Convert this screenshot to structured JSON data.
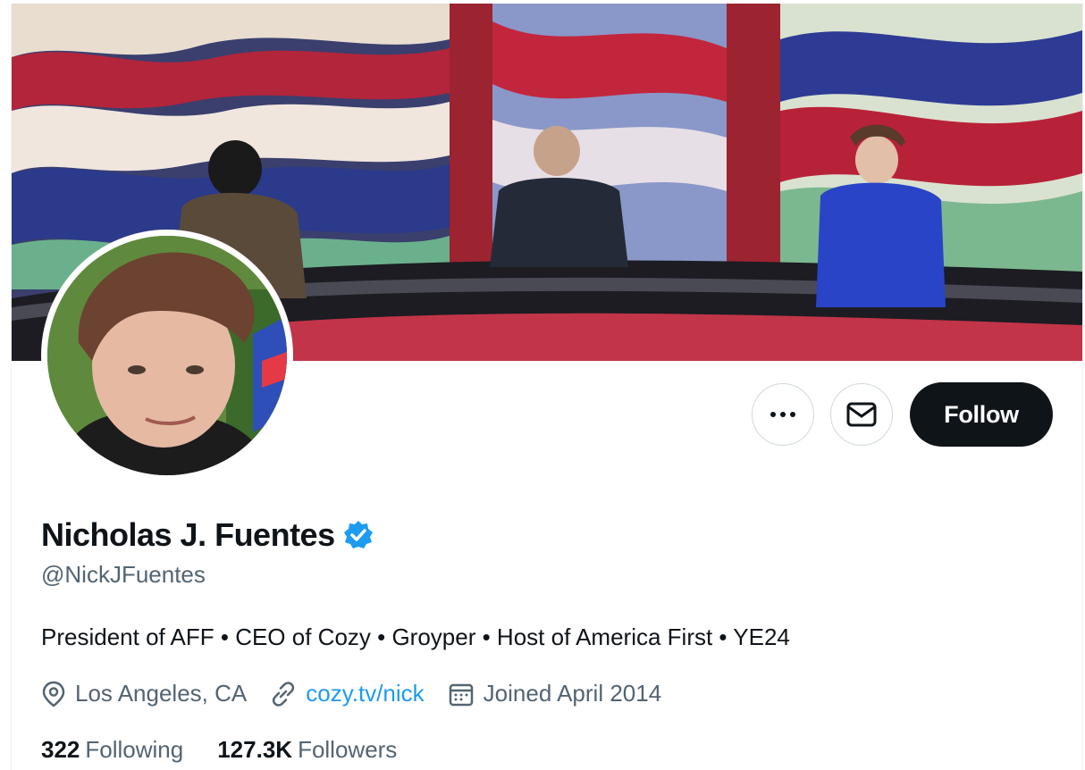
{
  "profile": {
    "display_name": "Nicholas J. Fuentes",
    "handle": "@NickJFuentes",
    "bio": "President of AFF • CEO of Cozy • Groyper • Host of America First • YE24",
    "location": "Los Angeles, CA",
    "website": "cozy.tv/nick",
    "joined": "Joined April 2014",
    "following_count": "322",
    "following_label": "Following",
    "followers_count": "127.3K",
    "followers_label": "Followers"
  },
  "actions": {
    "more_label": "•••",
    "follow_label": "Follow"
  },
  "icons": {
    "verified": "verified-badge-icon",
    "location": "location-pin-icon",
    "link": "link-icon",
    "calendar": "calendar-icon",
    "message": "envelope-icon",
    "more": "more-icon"
  },
  "colors": {
    "accent": "#1d9bf0",
    "follow_bg": "#0f1419",
    "secondary_text": "#536471"
  }
}
